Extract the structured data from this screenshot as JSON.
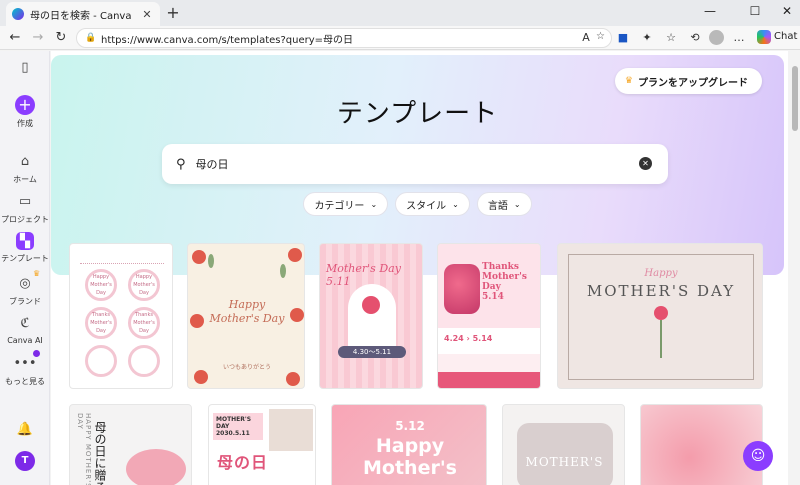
{
  "browser": {
    "tab_title": "母の日を検索 - Canva",
    "url": "https://www.canva.com/s/templates?query=母の日",
    "chat_label": "Chat",
    "reader_label": "Aᴬ"
  },
  "rail": {
    "create": "作成",
    "home": "ホーム",
    "projects": "プロジェクト",
    "templates": "テンプレート",
    "brand": "ブランド",
    "canva_ai": "Canva AI",
    "more": "もっと見る",
    "user_initial": "T"
  },
  "hero": {
    "upgrade_label": "プランをアップグレード",
    "title": "テンプレート",
    "search_value": "母の日",
    "filters": [
      "カテゴリー",
      "スタイル",
      "言語"
    ]
  },
  "cards": {
    "c1_circles": [
      "Happy Mother's Day",
      "Happy Mother's Day",
      "Thanks Mother's Day",
      "Thanks Mother's Day",
      "",
      ""
    ],
    "c2_title_1": "Happy",
    "c2_title_2": "Mother's Day",
    "c2_sub": "いつもありがとう",
    "c3_title_1": "Mother's Day",
    "c3_title_2": "5.11",
    "c3_date": "4.30～5.11",
    "c4_title_1": "Thanks",
    "c4_title_2": "Mother's",
    "c4_title_3": "Day",
    "c4_badge": "5.14",
    "c4_dates": "4.24 › 5.14",
    "c5_happy": "Happy",
    "c5_title": "MOTHER'S DAY",
    "r1_vert": "HAPPY MOTHER'S DAY",
    "r1_big": "母の日に贈る",
    "r2_label_1": "MOTHER'S DAY",
    "r2_label_2": "2030.5.11",
    "r2_big": "母の日",
    "r3_date": "5.12",
    "r3_title_1": "Happy",
    "r3_title_2": "Mother's",
    "r4_title": "MOTHER'S"
  },
  "colors": {
    "accent": "#8b3dff",
    "rose": "#e0557a"
  }
}
